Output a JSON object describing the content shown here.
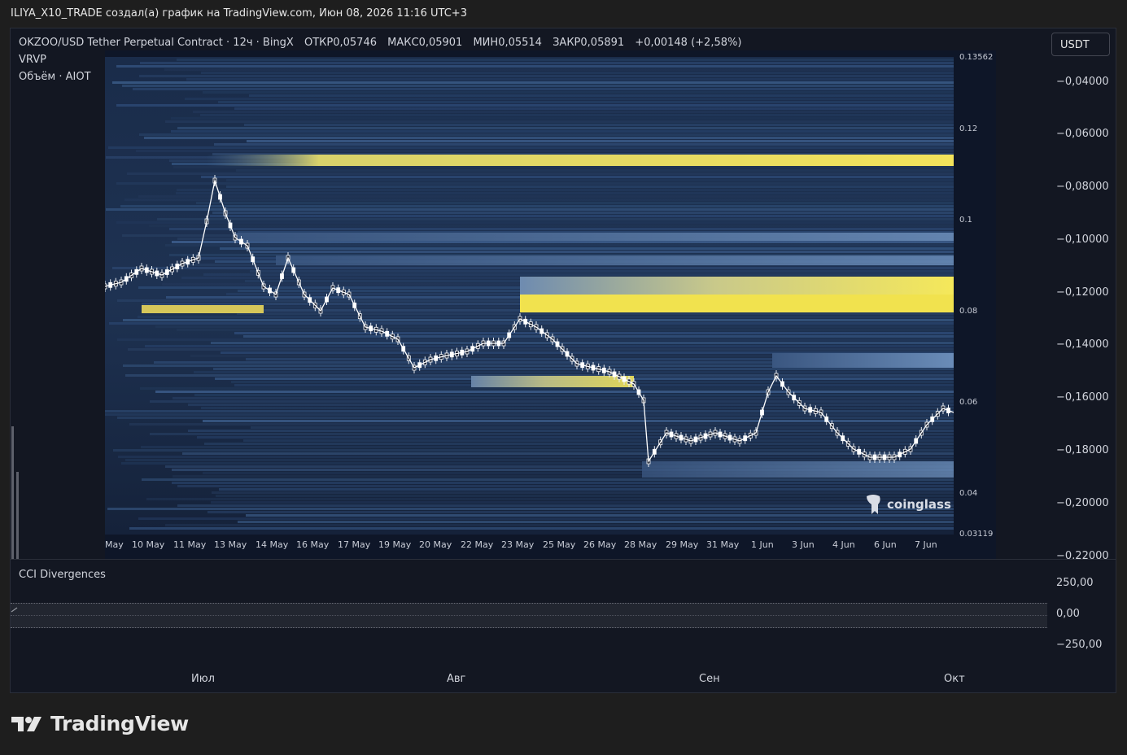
{
  "header": {
    "author_line": "ILIYA_X10_TRADE создал(а) график на TradingView.com, Июн 08, 2026 11:16 UTC+3"
  },
  "legend": {
    "symbol": "OKZOO/USD Tether Perpetual Contract · 12ч · BingX",
    "ohlc": [
      {
        "label": "ОТКР",
        "value": "0,05746"
      },
      {
        "label": "МАКС",
        "value": "0,05901"
      },
      {
        "label": "МИН",
        "value": "0,05514"
      },
      {
        "label": "ЗАКР",
        "value": "0,05891"
      }
    ],
    "change": "+0,00148 (+2,58%)",
    "indicator1": "VRVP",
    "indicator2": "Объём · AIOT"
  },
  "currency_button": "USDT",
  "price_axis": [
    "−0,04000",
    "−0,06000",
    "−0,08000",
    "−0,10000",
    "−0,12000",
    "−0,14000",
    "−0,16000",
    "−0,18000",
    "−0,20000",
    "−0,22000"
  ],
  "heatmap": {
    "right_axis": [
      "0.13562",
      "0.12",
      "0.1",
      "0.08",
      "0.06",
      "0.04",
      "0.03119"
    ],
    "date_axis": [
      "May",
      "10 May",
      "11 May",
      "13 May",
      "14 May",
      "16 May",
      "17 May",
      "19 May",
      "20 May",
      "22 May",
      "23 May",
      "25 May",
      "26 May",
      "28 May",
      "29 May",
      "31 May",
      "1 Jun",
      "3 Jun",
      "4 Jun",
      "6 Jun",
      "7 Jun"
    ],
    "watermark": "coinglass"
  },
  "cci": {
    "title": "CCI Divergences",
    "axis": [
      "250,00",
      "0,00",
      "−250,00"
    ]
  },
  "time_axis": [
    "Июл",
    "Авг",
    "Сен",
    "Окт"
  ],
  "branding": {
    "name": "TradingView"
  },
  "colors": {
    "background": "#131722",
    "page": "#1e1e1e",
    "heat_low": "#1b2b45",
    "heat_high": "#f3e35b",
    "candle": "#ffffff"
  }
}
